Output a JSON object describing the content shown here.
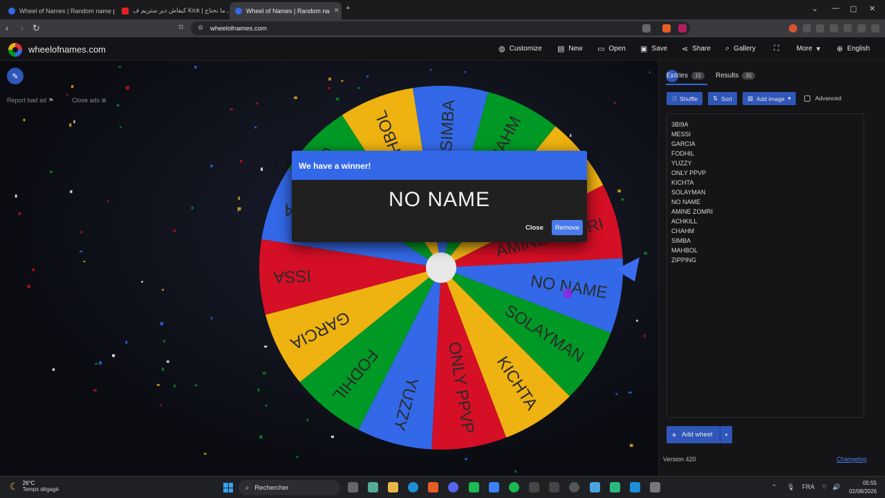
{
  "browser": {
    "tabs": [
      {
        "title": "Wheel of Names | Random name pick",
        "active": false,
        "color": "#3369e8"
      },
      {
        "title": "كيفاش دير ستريم ف Kick | كل ما تحتاج ...",
        "active": false,
        "color": "#e02424"
      },
      {
        "title": "Wheel of Names | Random na",
        "active": true,
        "color": "#3369e8"
      }
    ],
    "url": "wheelofnames.com"
  },
  "header": {
    "site_name": "wheelofnames.com",
    "buttons": [
      {
        "label": "Customize",
        "icon": "palette-icon"
      },
      {
        "label": "New",
        "icon": "new-file-icon"
      },
      {
        "label": "Open",
        "icon": "folder-icon"
      },
      {
        "label": "Save",
        "icon": "save-icon"
      },
      {
        "label": "Share",
        "icon": "share-icon"
      },
      {
        "label": "Gallery",
        "icon": "search-icon"
      },
      {
        "label": "",
        "icon": "fullscreen-icon"
      },
      {
        "label": "More",
        "icon": "chevron-down-icon"
      },
      {
        "label": "English",
        "icon": "globe-icon"
      }
    ]
  },
  "stage": {
    "report_ad": "Report bad ad",
    "close_ads": "Close ads"
  },
  "wheel": {
    "visible_labels": [
      "SIMBA",
      "CHAHM",
      "ACHKILL",
      "AMINE ZOMRI",
      "NO NAME",
      "SOLAYMAN",
      "KICHTA",
      "ONLY PPVP",
      "YUZZY",
      "FODHIL",
      "GARCIA",
      "ISSA",
      "3BI9A",
      "ZIPPING",
      "MAHBOL"
    ],
    "colors": {
      "yellow": "#eeb211",
      "red": "#d50f25",
      "blue": "#3369e8",
      "green": "#009925"
    }
  },
  "dialog": {
    "title": "We have a winner!",
    "winner": "NO NAME",
    "close_label": "Close",
    "remove_label": "Remove"
  },
  "panel": {
    "entries_tab": "Entries",
    "entries_count": "15",
    "results_tab": "Results",
    "results_count": "35",
    "shuffle": "Shuffle",
    "sort": "Sort",
    "add_image": "Add image",
    "advanced": "Advanced",
    "entries": [
      "3BI9A",
      "MESSI",
      "GARCIA",
      "FODHIL",
      "YUZZY",
      "ONLY PPVP",
      "KICHTA",
      "SOLAYMAN",
      "NO NAME",
      "AMINE ZOMRI",
      "ACHKILL",
      "CHAHM",
      "SIMBA",
      "MAHBOL",
      "ZIPPING"
    ],
    "add_wheel": "Add wheel",
    "version": "Version 420",
    "changelog": "Changelog"
  },
  "taskbar": {
    "temperature": "26°C",
    "weather": "Temps dégagé",
    "search": "Rechercher",
    "lang": "FRA",
    "time": "05:55",
    "date": "02/08/2026"
  }
}
